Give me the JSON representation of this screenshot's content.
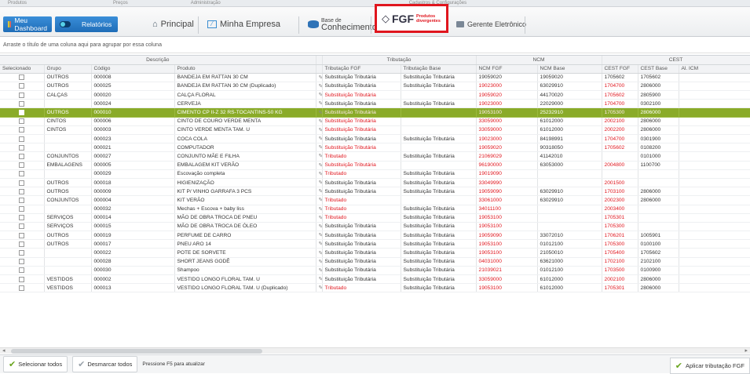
{
  "top_menu": [
    "Produtos",
    "Preços",
    "Administração",
    "Cadastros & Configurações"
  ],
  "toolbar": {
    "dashboard": "Meu Dashboard",
    "reports": "Relatórios",
    "principal": "Principal",
    "minha_empresa": "Minha Empresa",
    "base_top": "Base de",
    "base_bottom": "Conhecimento",
    "fgf_logo": "FGF",
    "fgf_sub_1": "Produtos",
    "fgf_sub_2": "divergentes",
    "gerente": "Gerente Eletrônico"
  },
  "group_hint": "Arraste o título de uma coluna aqui para agrupar por essa coluna",
  "bands": {
    "descricao": "Descrição",
    "tributacao": "Tributação",
    "ncm": "NCM",
    "cest": "CEST"
  },
  "columns": [
    "Selecionado",
    "Grupo",
    "Código",
    "Produto",
    "Tributação FGF",
    "Tributação Base",
    "NCM FGF",
    "NCM Base",
    "CEST FGF",
    "CEST Base",
    "Al. ICM"
  ],
  "rows": [
    {
      "grupo": "OUTROS",
      "codigo": "000008",
      "produto": "BANDEJA EM RATTAN 30 CM",
      "trib_fgf": "Substituição Tributária",
      "trib_base": "Substituição Tributária",
      "ncm_fgf": "19059020",
      "ncm_base": "19059020",
      "cest_fgf": "1705602",
      "cest_base": "1705602"
    },
    {
      "grupo": "OUTROS",
      "codigo": "000025",
      "produto": "BANDEJA EM RATTAN 30 CM (Duplicado)",
      "trib_fgf": "Substituição Tributária",
      "trib_base": "Substituição Tributária",
      "ncm_fgf": "19023000",
      "ncm_base": "63029910",
      "cest_fgf": "1704700",
      "cest_base": "2806000"
    },
    {
      "grupo": "CALÇAS",
      "codigo": "000020",
      "produto": "CALÇA FLORAL",
      "trib_fgf": "Substituição Tributária",
      "trib_base": "",
      "ncm_fgf": "19059020",
      "ncm_base": "44170020",
      "cest_fgf": "1705602",
      "cest_base": "2805900"
    },
    {
      "grupo": "",
      "codigo": "000024",
      "produto": "CERVEJA",
      "trib_fgf": "Substituição Tributária",
      "trib_base": "Substituição Tributária",
      "ncm_fgf": "19023000",
      "ncm_base": "22029000",
      "cest_fgf": "1704700",
      "cest_base": "0302100"
    },
    {
      "grupo": "OUTROS",
      "codigo": "000010",
      "produto": "CIMENTO CP II-Z 32 RS-TOCANTINS-50 KG",
      "trib_fgf": "Substituição Tributária",
      "trib_base": "",
      "ncm_fgf": "19053100",
      "ncm_base": "25232910",
      "cest_fgf": "1705300",
      "cest_base": "2806000",
      "selected": true
    },
    {
      "grupo": "CINTOS",
      "codigo": "000006",
      "produto": "CINTO DE COURO VERDE MENTA",
      "trib_fgf": "Substituição Tributária",
      "trib_base": "",
      "ncm_fgf": "33059000",
      "ncm_base": "61012000",
      "cest_fgf": "2002100",
      "cest_base": "2806000"
    },
    {
      "grupo": "CINTOS",
      "codigo": "000003",
      "produto": "CINTO VERDE MENTA TAM. U",
      "trib_fgf": "Substituição Tributária",
      "trib_base": "",
      "ncm_fgf": "33059000",
      "ncm_base": "61012000",
      "cest_fgf": "2002200",
      "cest_base": "2806000"
    },
    {
      "grupo": "",
      "codigo": "000023",
      "produto": "COCA COLA",
      "trib_fgf": "Substituição Tributária",
      "trib_base": "Substituição Tributária",
      "ncm_fgf": "19023000",
      "ncm_base": "84198991",
      "cest_fgf": "1704700",
      "cest_base": "0301900"
    },
    {
      "grupo": "",
      "codigo": "000021",
      "produto": "COMPUTADOR",
      "trib_fgf": "Substituição Tributária",
      "trib_base": "",
      "ncm_fgf": "19059020",
      "ncm_base": "90318050",
      "cest_fgf": "1705602",
      "cest_base": "0108200"
    },
    {
      "grupo": "CONJUNTOS",
      "codigo": "000027",
      "produto": "CONJUNTO MÃE E FILHA",
      "trib_fgf": "Tributado",
      "trib_base": "Substituição Tributária",
      "ncm_fgf": "21069029",
      "ncm_base": "41142010",
      "cest_fgf": "",
      "cest_base": "0101000"
    },
    {
      "grupo": "EMBALAGENS",
      "codigo": "000005",
      "produto": "EMBALAGEM KIT VERÃO",
      "trib_fgf": "Substituição Tributária",
      "trib_base": "",
      "ncm_fgf": "96190000",
      "ncm_base": "63053000",
      "cest_fgf": "2004800",
      "cest_base": "1100700"
    },
    {
      "grupo": "",
      "codigo": "000029",
      "produto": "Escovação completa",
      "trib_fgf": "Tributado",
      "trib_base": "Substituição Tributária",
      "ncm_fgf": "19019090",
      "ncm_base": "",
      "cest_fgf": "",
      "cest_base": ""
    },
    {
      "grupo": "OUTROS",
      "codigo": "000018",
      "produto": "HIGIENIZAÇÃO",
      "trib_fgf": "Substituição Tributária",
      "trib_base": "Substituição Tributária",
      "ncm_fgf": "33049990",
      "ncm_base": "",
      "cest_fgf": "2001500",
      "cest_base": ""
    },
    {
      "grupo": "OUTROS",
      "codigo": "000009",
      "produto": "KIT P/ VINHO GARRAFA 3 PCS",
      "trib_fgf": "Substituição Tributária",
      "trib_base": "Substituição Tributária",
      "ncm_fgf": "19059090",
      "ncm_base": "63029910",
      "cest_fgf": "1703100",
      "cest_base": "2806000"
    },
    {
      "grupo": "CONJUNTOS",
      "codigo": "000004",
      "produto": "KIT VERÃO",
      "trib_fgf": "Tributado",
      "trib_base": "",
      "ncm_fgf": "33061000",
      "ncm_base": "63029910",
      "cest_fgf": "2002300",
      "cest_base": "2806000"
    },
    {
      "grupo": "",
      "codigo": "000032",
      "produto": "Mechas + Escova + baby liss",
      "trib_fgf": "Tributado",
      "trib_base": "Substituição Tributária",
      "ncm_fgf": "34011100",
      "ncm_base": "",
      "cest_fgf": "2003400",
      "cest_base": ""
    },
    {
      "grupo": "SERVIÇOS",
      "codigo": "000014",
      "produto": "MÃO DE OBRA TROCA DE PNEU",
      "trib_fgf": "Tributado",
      "trib_base": "Substituição Tributária",
      "ncm_fgf": "19053100",
      "ncm_base": "",
      "cest_fgf": "1705301",
      "cest_base": ""
    },
    {
      "grupo": "SERVIÇOS",
      "codigo": "000015",
      "produto": "MÃO DE OBRA TROCA DE ÓLEO",
      "trib_fgf": "Substituição Tributária",
      "trib_base": "Substituição Tributária",
      "ncm_fgf": "19053100",
      "ncm_base": "",
      "cest_fgf": "1705300",
      "cest_base": ""
    },
    {
      "grupo": "OUTROS",
      "codigo": "000019",
      "produto": "PERFUME DE CARRO",
      "trib_fgf": "Substituição Tributária",
      "trib_base": "Substituição Tributária",
      "ncm_fgf": "19059090",
      "ncm_base": "33072010",
      "cest_fgf": "1706201",
      "cest_base": "1005901"
    },
    {
      "grupo": "OUTROS",
      "codigo": "000017",
      "produto": "PNEU ARO 14",
      "trib_fgf": "Substituição Tributária",
      "trib_base": "Substituição Tributária",
      "ncm_fgf": "19053100",
      "ncm_base": "01012100",
      "cest_fgf": "1705300",
      "cest_base": "0100100"
    },
    {
      "grupo": "",
      "codigo": "000022",
      "produto": "POTE DE SORVETE",
      "trib_fgf": "Substituição Tributária",
      "trib_base": "Substituição Tributária",
      "ncm_fgf": "19053100",
      "ncm_base": "21050010",
      "cest_fgf": "1705400",
      "cest_base": "1705602"
    },
    {
      "grupo": "",
      "codigo": "000028",
      "produto": "SHORT JEANS GODÊ",
      "trib_fgf": "Substituição Tributária",
      "trib_base": "Substituição Tributária",
      "ncm_fgf": "04031000",
      "ncm_base": "63621000",
      "cest_fgf": "1702100",
      "cest_base": "2102100"
    },
    {
      "grupo": "",
      "codigo": "000030",
      "produto": "Shampoo",
      "trib_fgf": "Substituição Tributária",
      "trib_base": "Substituição Tributária",
      "ncm_fgf": "21039021",
      "ncm_base": "01012100",
      "cest_fgf": "1703500",
      "cest_base": "0100900"
    },
    {
      "grupo": "VESTIDOS",
      "codigo": "000002",
      "produto": "VESTIDO LONGO FLORAL TAM. U",
      "trib_fgf": "Substituição Tributária",
      "trib_base": "Substituição Tributária",
      "ncm_fgf": "33059000",
      "ncm_base": "61012000",
      "cest_fgf": "2002100",
      "cest_base": "2806000"
    },
    {
      "grupo": "VESTIDOS",
      "codigo": "000013",
      "produto": "VESTIDO LONGO FLORAL TAM. U (Duplicado)",
      "trib_fgf": "Tributado",
      "trib_base": "Substituição Tributária",
      "ncm_fgf": "19053100",
      "ncm_base": "61012000",
      "cest_fgf": "1705301",
      "cest_base": "2806000"
    }
  ],
  "footer": {
    "select_all": "Selecionar todos",
    "deselect_all": "Desmarcar todos",
    "hint": "Pressione F5 para atualizar",
    "apply": "Aplicar tributação FGF"
  },
  "colors": {
    "selected_row": "#8aab29",
    "divergent": "#e0161e",
    "accent": "#1f6db8"
  }
}
